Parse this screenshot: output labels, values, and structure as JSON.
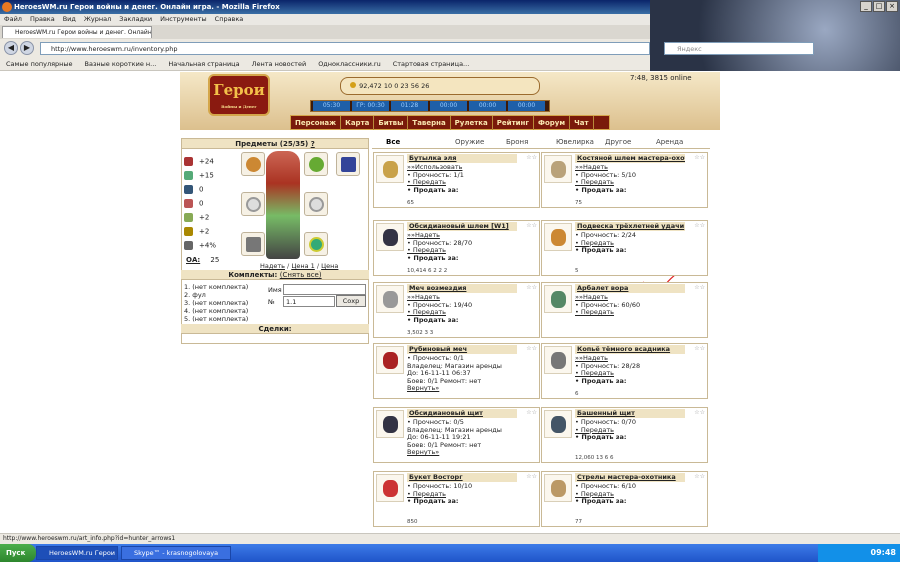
{
  "browser": {
    "window_title": "HeroesWM.ru Герои войны и денег. Онлайн игра. - Mozilla Firefox",
    "menu": [
      "Файл",
      "Правка",
      "Вид",
      "Журнал",
      "Закладки",
      "Инструменты",
      "Справка"
    ],
    "tab_title": "HeroesWM.ru Герои войны и денег. Онлайн...",
    "url": "http://www.heroeswm.ru/inventory.php",
    "search_placeholder": "Яндекс",
    "bookmarks": [
      "Самые популярные",
      "Вазные короткие н...",
      "Начальная страница",
      "Лента новостей",
      "Одноклассники.ru",
      "Стартовая страница..."
    ],
    "status_url": "http://www.heroeswm.ru/art_info.php?id=hunter_arrows1"
  },
  "game": {
    "logo": "Герои",
    "logo_sub": "Войны и Денег",
    "resources": "92,472  10  0  23  56  26",
    "timers": [
      "05:30",
      "ГР: 00:30",
      "01:28",
      "00:00",
      "00:00",
      "00:00"
    ],
    "online": "7:48, 3815 online",
    "nav": [
      "Персонаж",
      "Карта",
      "Битвы",
      "Таверна",
      "Рулетка",
      "Рейтинг",
      "Форум",
      "Чат"
    ]
  },
  "inventory": {
    "header": "Предметы (25/35)",
    "help": "?",
    "stats": [
      {
        "value": "+24",
        "color": "#a33"
      },
      {
        "value": "+15",
        "color": "#5a7"
      },
      {
        "value": "0",
        "color": "#357"
      },
      {
        "value": "0",
        "color": "#b55"
      },
      {
        "value": "+2",
        "color": "#8a5"
      },
      {
        "value": "+2",
        "color": "#a80"
      },
      {
        "value": "+4%",
        "color": "#666"
      }
    ],
    "oa_label": "ОА:",
    "oa_value": "25",
    "sort_prefix": "Надеть",
    "sort_price1": "Цена 1",
    "sort_price": "Цена",
    "sort_sep": " / ",
    "sets_header": "Комплекты:",
    "sets_reset": "(Снять все)",
    "sets": [
      "1. (нет комплекта)",
      "2. фул",
      "3. (нет комплекта)",
      "4. (нет комплекта)",
      "5. (нет комплекта)"
    ],
    "name_label": "Имя",
    "num_label": "№",
    "num_value": "1.1",
    "save_button": "Сохр",
    "deals_header": "Сделки:"
  },
  "tabs": [
    "Все",
    "Оружие",
    "Броня",
    "Ювелирка",
    "Другое",
    "Аренда"
  ],
  "items_left": [
    {
      "title": "Бутылка эля",
      "lines": [
        [
          "link",
          "»»Использовать"
        ],
        [
          "text",
          "• Прочность: 1/1"
        ],
        [
          "link",
          "• Передать"
        ],
        [
          "bold",
          "• Продать за:"
        ]
      ],
      "foot": "65",
      "color": "#c9a24a"
    },
    {
      "title": "Обсидиановый шлем [W1]",
      "lines": [
        [
          "link",
          "»»Надеть"
        ],
        [
          "text",
          "• Прочность: 28/70"
        ],
        [
          "link",
          "• Передать"
        ],
        [
          "bold",
          "• Продать за:"
        ]
      ],
      "foot": "10,414  6  2  2  2",
      "color": "#334"
    },
    {
      "title": "Меч возмездия",
      "lines": [
        [
          "link",
          "»»Надеть"
        ],
        [
          "text",
          "• Прочность: 19/40"
        ],
        [
          "link",
          "• Передать"
        ],
        [
          "bold",
          "• Продать за:"
        ]
      ],
      "foot": "3,502  3  3",
      "color": "#999"
    },
    {
      "title": "Рубиновый меч",
      "lines": [
        [
          "text",
          "• Прочность: 0/1"
        ],
        [
          "text",
          "Владелец: Магазин аренды"
        ],
        [
          "text",
          "До: 16-11-11 06:37"
        ],
        [
          "text",
          "Боев: 0/1  Ремонт: нет"
        ],
        [
          "link",
          "Вернуть»"
        ]
      ],
      "foot": "",
      "color": "#a22"
    },
    {
      "title": "Обсидиановый щит",
      "lines": [
        [
          "text",
          "• Прочность: 0/5"
        ],
        [
          "text",
          "Владелец: Магазин аренды"
        ],
        [
          "text",
          "До: 06-11-11 19:21"
        ],
        [
          "text",
          "Боев: 0/1  Ремонт: нет"
        ],
        [
          "link",
          "Вернуть»"
        ]
      ],
      "foot": "",
      "color": "#334"
    },
    {
      "title": "Букет Восторг",
      "lines": [
        [
          "text",
          "• Прочность: 10/10"
        ],
        [
          "link",
          "• Передать"
        ],
        [
          "bold",
          "• Продать за:"
        ]
      ],
      "foot": "850",
      "color": "#c33"
    }
  ],
  "items_right": [
    {
      "title": "Костяной шлем мастера-охотника",
      "lines": [
        [
          "link",
          "»»Надеть"
        ],
        [
          "text",
          "• Прочность: 5/10"
        ],
        [
          "link",
          "• Передать"
        ],
        [
          "bold",
          "• Продать за:"
        ]
      ],
      "foot": "75",
      "color": "#b9a27a"
    },
    {
      "title": "Подвеска трёхлетней удачи",
      "lines": [
        [
          "text",
          "• Прочность: 2/24"
        ],
        [
          "link",
          "• Передать"
        ],
        [
          "bold",
          "• Продать за:"
        ]
      ],
      "foot": "5",
      "color": "#c83"
    },
    {
      "title": "Арбалет вора",
      "lines": [
        [
          "link",
          "»»Надеть"
        ],
        [
          "text",
          "• Прочность: 60/60"
        ],
        [
          "link",
          "• Передать"
        ]
      ],
      "foot": "",
      "color": "#586"
    },
    {
      "title": "Копьё тёмного всадника",
      "lines": [
        [
          "link",
          "»»Надеть"
        ],
        [
          "text",
          "• Прочность: 28/28"
        ],
        [
          "link",
          "• Передать"
        ],
        [
          "bold",
          "• Продать за:"
        ]
      ],
      "foot": "6",
      "color": "#777"
    },
    {
      "title": "Башенный щит",
      "lines": [
        [
          "text",
          "• Прочность: 0/70"
        ],
        [
          "link",
          "• Передать"
        ],
        [
          "bold",
          "• Продать за:"
        ]
      ],
      "foot": "12,060  13  6  6",
      "color": "#456"
    },
    {
      "title": "Стрелы мастера-охотника",
      "lines": [
        [
          "text",
          "• Прочность: 6/10"
        ],
        [
          "link",
          "• Передать"
        ],
        [
          "bold",
          "• Продать за:"
        ]
      ],
      "foot": "77",
      "color": "#b96"
    }
  ],
  "taskbar": {
    "start": "Пуск",
    "tasks": [
      "HeroesWM.ru Герои во...",
      "Skype™ - krasnogolovaya"
    ],
    "clock": "09:48"
  }
}
